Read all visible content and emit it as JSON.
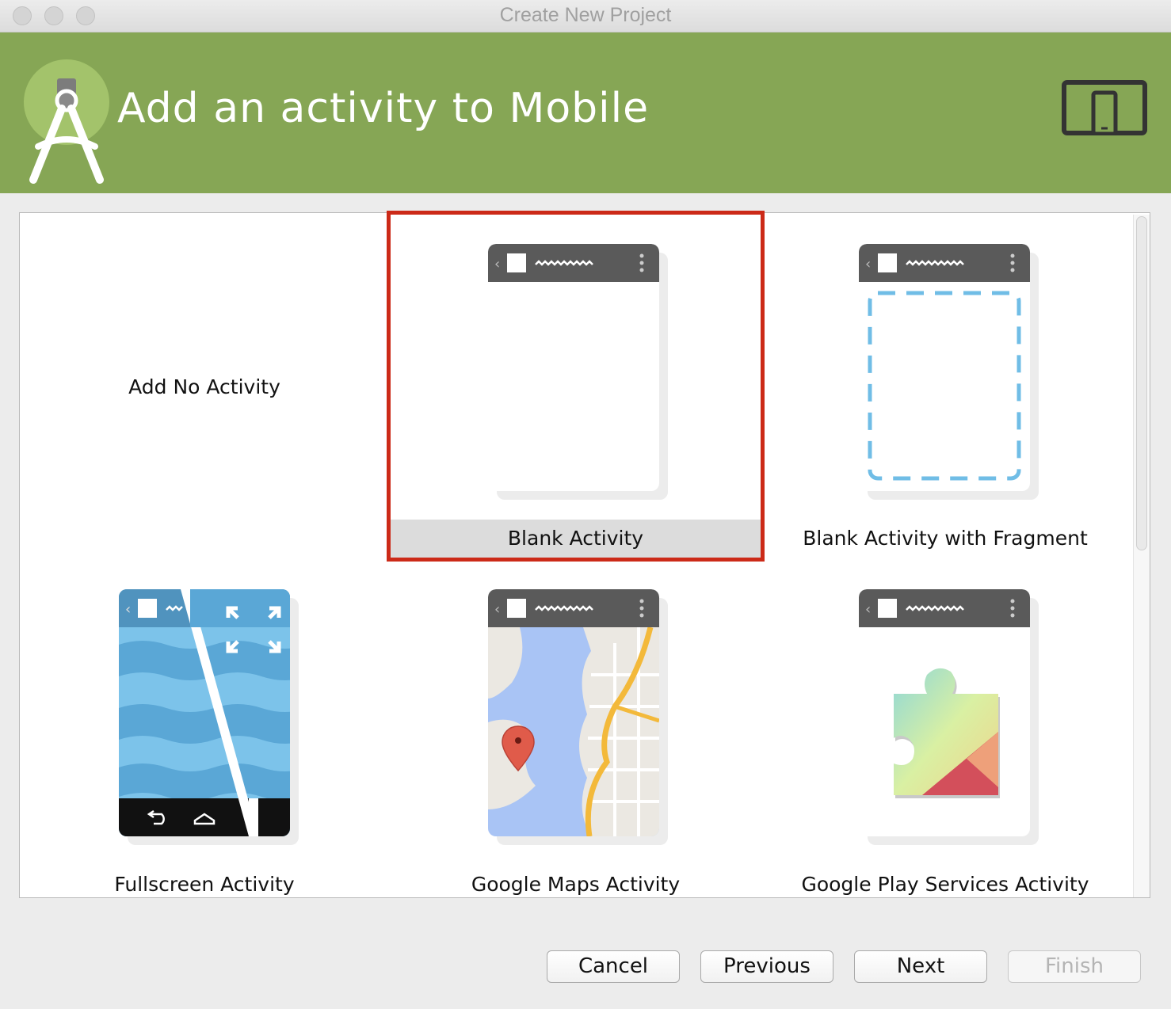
{
  "window": {
    "title": "Create New Project"
  },
  "header": {
    "title": "Add an activity to Mobile"
  },
  "tiles": [
    {
      "label": "Add No Activity"
    },
    {
      "label": "Blank Activity",
      "selected": true
    },
    {
      "label": "Blank Activity with Fragment"
    },
    {
      "label": "Fullscreen Activity"
    },
    {
      "label": "Google Maps Activity"
    },
    {
      "label": "Google Play Services Activity"
    }
  ],
  "buttons": {
    "cancel": "Cancel",
    "previous": "Previous",
    "next": "Next",
    "finish": "Finish"
  },
  "colors": {
    "banner": "#86a655",
    "selection": "#cc2a18",
    "fragment_dash": "#70bde6"
  }
}
